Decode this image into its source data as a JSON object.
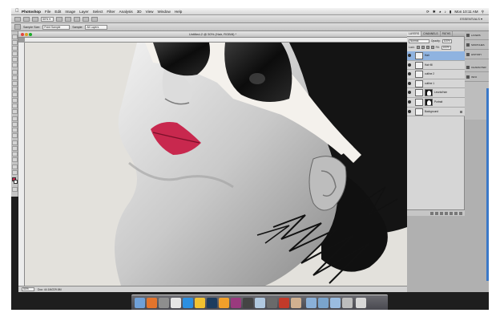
{
  "menubar": {
    "app_name": "Photoshop",
    "items": [
      "File",
      "Edit",
      "Image",
      "Layer",
      "Select",
      "Filter",
      "Analysis",
      "3D",
      "View",
      "Window",
      "Help"
    ],
    "clock": "Mon 10:11 AM"
  },
  "appbar": {
    "zoom": "50% ▾",
    "workspace": "ESSENTIALS ▾"
  },
  "options": {
    "sample_label": "Sample Size:",
    "sample_value": "Point Sample",
    "layers_label": "Sample:",
    "layers_value": "All Layers"
  },
  "document": {
    "title": "Untitled-2 @ 50% (Hair, RGB/8) *",
    "zoom": "50%",
    "info": "Doc: 44.1M/229.8M"
  },
  "panels": {
    "layers_tabs": [
      "LAYERS",
      "CHANNELS",
      "PATHS"
    ],
    "blend_mode": "Normal",
    "opacity_label": "Opacity:",
    "opacity": "100%",
    "lock_label": "Lock:",
    "fill_label": "Fill:",
    "fill": "100%",
    "layers": [
      {
        "name": "Hair",
        "selected": true,
        "masked": false
      },
      {
        "name": "Hair fill",
        "selected": false,
        "masked": false
      },
      {
        "name": "outline 2",
        "selected": false,
        "masked": false
      },
      {
        "name": "outline 1",
        "selected": false,
        "masked": false
      },
      {
        "name": "Levels/Hair",
        "selected": false,
        "masked": true
      },
      {
        "name": "Portrait",
        "selected": false,
        "masked": true
      },
      {
        "name": "Background",
        "selected": false,
        "masked": false
      }
    ],
    "dock_items": [
      "LAYERS",
      "SWATCHES",
      "HISTORY",
      "CHARACTER",
      "INFO"
    ]
  },
  "colors": {
    "foreground": "#c8284e",
    "background": "#ffffff",
    "selection": "#8fb3e0"
  }
}
